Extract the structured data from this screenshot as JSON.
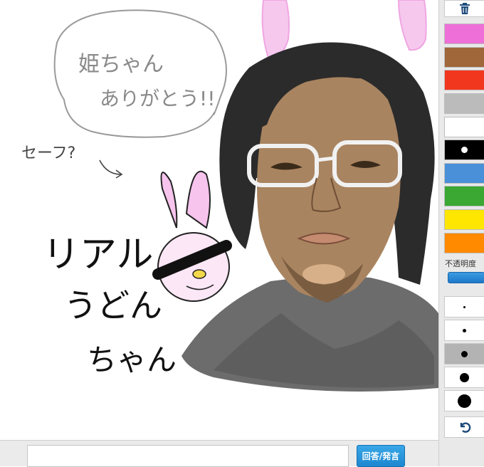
{
  "canvas": {
    "speech_line1": "姫ちゃん",
    "speech_line2": "ありがとう!!",
    "safe_text": "セーフ?",
    "title_line1": "リアル",
    "title_line2": "うどん",
    "title_line3": "ちゃん"
  },
  "toolbar": {
    "trash_icon": "trash-icon",
    "colors": [
      "#ee6fd8",
      "#a0673a",
      "#f2371f",
      "#bbbbbb",
      "#ffffff",
      "#000000",
      "#4a90d8",
      "#3aa832",
      "#ffe600",
      "#ff8a00"
    ],
    "selected_color": "#000000",
    "opacity_label": "不透明度",
    "opacity_level": 1.0,
    "brush_sizes": [
      "1",
      "2",
      "3",
      "4",
      "5"
    ],
    "selected_size": "3",
    "undo_icon": "undo-icon"
  },
  "footer": {
    "input_value": "",
    "submit_label": "回答/発言"
  }
}
